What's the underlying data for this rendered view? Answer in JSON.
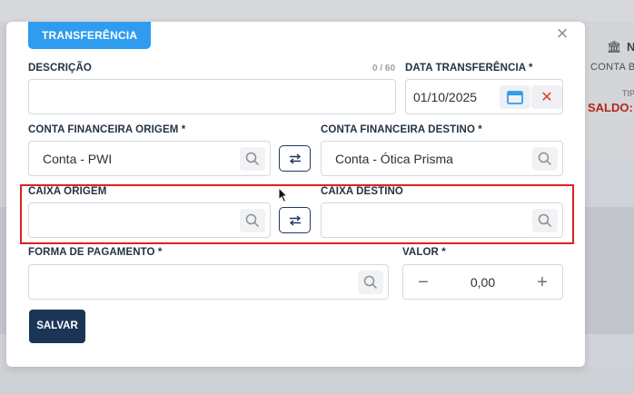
{
  "background": {
    "conta_label": "CONTA B",
    "tipo_label": "TIP",
    "saldo_label": "SALDO:",
    "bank_letter": "N"
  },
  "modal": {
    "tab_label": "TRANSFERÊNCIA",
    "close_icon": "close-icon"
  },
  "form": {
    "descricao": {
      "label": "DESCRIÇÃO",
      "value": "",
      "counter": "0 / 60"
    },
    "data_transferencia": {
      "label": "DATA TRANSFERÊNCIA *",
      "value": "01/10/2025"
    },
    "conta_origem": {
      "label": "CONTA FINANCEIRA ORIGEM *",
      "value": "Conta - PWI"
    },
    "conta_destino": {
      "label": "CONTA FINANCEIRA DESTINO *",
      "value": "Conta - Ótica Prisma"
    },
    "caixa_origem": {
      "label": "CAIXA ORIGEM",
      "value": ""
    },
    "caixa_destino": {
      "label": "CAIXA DESTINO",
      "value": ""
    },
    "forma_pagamento": {
      "label": "FORMA DE PAGAMENTO *",
      "value": ""
    },
    "valor": {
      "label": "VALOR *",
      "value": "0,00",
      "minus": "−",
      "plus": "+"
    },
    "save_label": "SALVAR"
  },
  "colors": {
    "primary_tab": "#2f9cef",
    "save_button": "#1b3556",
    "clear_red": "#e53935",
    "highlight": "#e02020"
  }
}
